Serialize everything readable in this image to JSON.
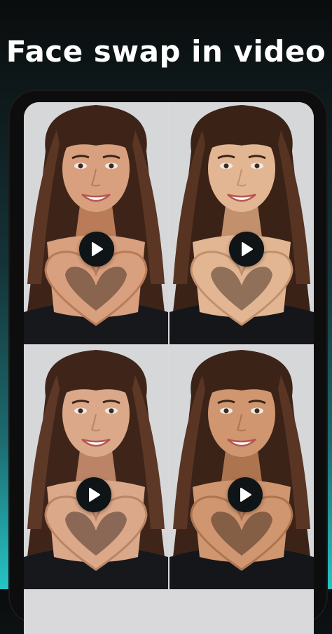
{
  "header": {
    "title": "Face swap in video"
  },
  "gallery": {
    "items": [
      {
        "id": "video-1",
        "play_icon": "play-icon",
        "skin": "#d8a07e",
        "skin_shade": "#b97b58",
        "hair": "#3e2418",
        "hair_hi": "#5b3624",
        "top": "#16181c"
      },
      {
        "id": "video-2",
        "play_icon": "play-icon",
        "skin": "#e3b693",
        "skin_shade": "#c2906c",
        "hair": "#3a2217",
        "hair_hi": "#573322",
        "top": "#14161a"
      },
      {
        "id": "video-3",
        "play_icon": "play-icon",
        "skin": "#dba88a",
        "skin_shade": "#bb8466",
        "hair": "#3f2519",
        "hair_hi": "#5e3827",
        "top": "#16181c"
      },
      {
        "id": "video-4",
        "play_icon": "play-icon",
        "skin": "#cf9670",
        "skin_shade": "#ad7450",
        "hair": "#3b2318",
        "hair_hi": "#5a3524",
        "top": "#14161a"
      }
    ]
  },
  "colors": {
    "background_top": "#0a0c0d",
    "background_bottom": "#27c4c4",
    "phone_frame": "#0d0d0d",
    "play_button": "#0f1416",
    "play_triangle": "#ffffff"
  }
}
